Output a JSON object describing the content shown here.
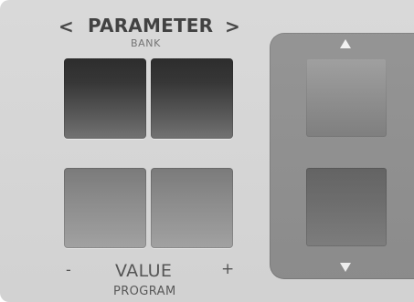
{
  "parameter": {
    "left_symbol": "<",
    "title": "PARAMETER",
    "right_symbol": ">",
    "sub": "BANK"
  },
  "value": {
    "minus": "-",
    "title": "VALUE",
    "plus": "+",
    "sub": "PROGRAM"
  },
  "icons": {
    "up": "triangle-up-icon",
    "down": "triangle-down-icon"
  },
  "colors": {
    "panel": "#d6d6d6",
    "rocker": "#8d8d8d",
    "arrow": "#f2f2f2"
  }
}
